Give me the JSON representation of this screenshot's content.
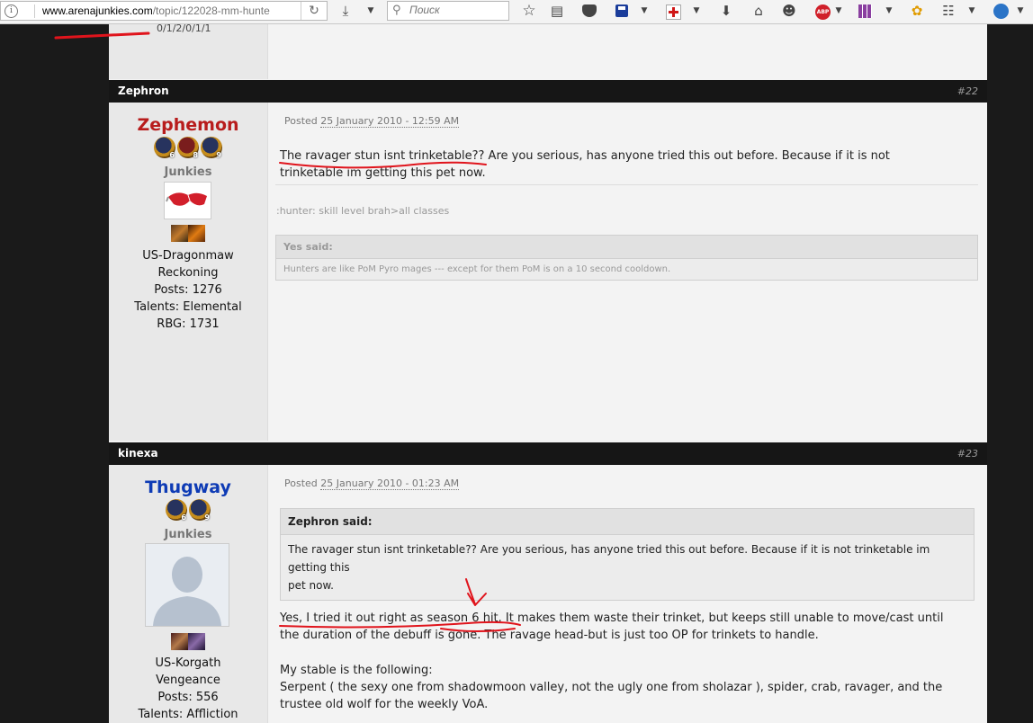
{
  "browser": {
    "url_domain": "www.arenajunkies.com",
    "url_path": "/topic/122028-mm-hunte",
    "search_placeholder": "Поиск",
    "abp_label": "ABP"
  },
  "page": {
    "truncated_text": "0/1/2/0/1/1"
  },
  "posts": [
    {
      "poster_header": "Zephron",
      "post_number": "#22",
      "username": "Zephemon",
      "username_color": "#b81c1c",
      "badges": [
        "6",
        "8",
        "9"
      ],
      "group": "Junkies",
      "info": [
        "US-Dragonmaw",
        "Reckoning",
        "Posts: 1276",
        "Talents: Elemental",
        "RBG: 1731"
      ],
      "posted_label": "Posted",
      "posted_date": "25 January 2010 - 12:59 AM",
      "body_lines": [
        "The ravager stun isnt trinketable?? Are you serious, has anyone tried this out before. Because if it is not",
        "trinketable im getting this pet now."
      ],
      "signature": ":hunter: skill level brah>all classes",
      "quote_header": "Yes said:",
      "quote_body": "Hunters are like PoM Pyro mages --- except for them PoM is on a 10 second cooldown."
    },
    {
      "poster_header": "kinexa",
      "post_number": "#23",
      "username": "Thugway",
      "username_color": "#0e3bb5",
      "badges": [
        "6",
        "9"
      ],
      "group": "Junkies",
      "info": [
        "US-Korgath",
        "Vengeance",
        "Posts: 556",
        "Talents: Affliction"
      ],
      "posted_label": "Posted",
      "posted_date": "25 January 2010 - 01:23 AM",
      "quote_header": "Zephron said:",
      "quote_lines": [
        "The ravager stun isnt trinketable?? Are you serious, has anyone tried this out before. Because if it is not trinketable im getting this",
        "pet now."
      ],
      "body_lines": [
        "Yes, I tried it out right as season 6 hit. It makes them waste their trinket, but keeps still unable to move/cast until",
        "the duration of the debuff is gone. The ravage head-but is just too OP for trinkets to handle."
      ],
      "body2_lines": [
        "My stable is the following:",
        "Serpent ( the sexy one from shadowmoon valley, not the ugly one from sholazar ), spider, crab, ravager, and the",
        "trustee old wolf for the weekly VoA."
      ]
    }
  ],
  "colors": {
    "accent_annotation": "#e0141c",
    "header_bg": "#161616"
  }
}
